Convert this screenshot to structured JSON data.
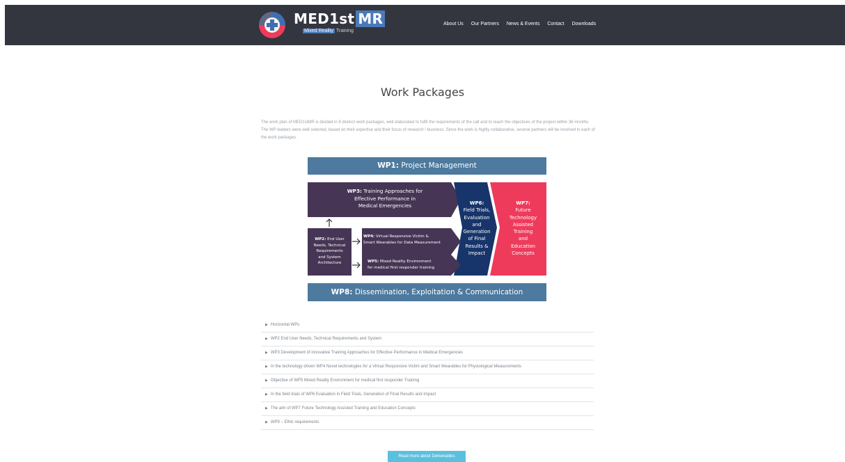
{
  "brand": {
    "name": "MED1st",
    "name_highlight": "MR",
    "subtitle_highlight": "Mixed Reality",
    "subtitle": "Training",
    "primary_color": "#33353f",
    "accent_color": "#4c7ab8"
  },
  "nav": {
    "items": [
      {
        "label": "About Us"
      },
      {
        "label": "Our Partners"
      },
      {
        "label": "News & Events"
      },
      {
        "label": "Contact"
      },
      {
        "label": "Downloads"
      }
    ]
  },
  "page": {
    "title": "Work Packages",
    "intro": "The work plan of MED1stMR is divided in 9 distinct work packages, well elaborated to fulfil the requirements of the call and to reach the objectives of the project within 36 months. The WP leaders were well selected, based on their expertise and their focus of research / business. Since the work is highly collaborative, several partners will be involved in each of the work packages."
  },
  "diagram": {
    "wp1": {
      "code": "WP1:",
      "text": "Project Management"
    },
    "wp3": {
      "code": "WP3:",
      "line1": "Training Approaches for",
      "line2": "Effective Performance in",
      "line3": "Medical Emergencies"
    },
    "wp2": {
      "code": "WP2:",
      "line1": "End User",
      "line2": "Needs, Technical",
      "line3": "Requirements",
      "line4": "and System",
      "line5": "Architecture"
    },
    "wp4": {
      "code": "WP4:",
      "line1": "Virtual Responsive Victim &",
      "line2": "Smart Wearables for Data Measurement"
    },
    "wp5": {
      "code": "WP5:",
      "line1": "Mixed Reality Environment",
      "line2": "for medical first responder training"
    },
    "wp6": {
      "code": "WP6:",
      "line1": "Field Trials,",
      "line2": "Evaluation",
      "line3": "and",
      "line4": "Generation",
      "line5": "of Final",
      "line6": "Results &",
      "line7": "Impact"
    },
    "wp7": {
      "code": "WP7:",
      "line1": "Future",
      "line2": "Technology",
      "line3": "Assisted",
      "line4": "Training",
      "line5": "and",
      "line6": "Education",
      "line7": "Concepts"
    },
    "wp8": {
      "code": "WP8:",
      "text": "Dissemination, Exploitation & Communication"
    },
    "colors": {
      "bar": "#4d7a9e",
      "purple": "#463554",
      "navy": "#17356b",
      "red": "#ee3b5c"
    }
  },
  "accordion": {
    "items": [
      {
        "label": "Horizontal WPs"
      },
      {
        "label": "WP2 End User Needs, Technical Requirements and System"
      },
      {
        "label": "WP3 Development of innovative Training Approaches for Effective Performance in Medical Emergencies"
      },
      {
        "label": "In the technology driven WP4 Novel technologies for a Virtual Responsive Victim and Smart Wearables for Physiological Measurements"
      },
      {
        "label": "Objective of WP5 Mixed Reality Environment for medical first responder Training"
      },
      {
        "label": "In the field trials of WP6 Evaluation in Field Trials, Generation of Final Results and Impact"
      },
      {
        "label": "The aim of WP7 Future Technology Assisted Training and Education Concepts"
      },
      {
        "label": "WP9 – Ethic requirements"
      }
    ]
  },
  "cta": {
    "label": "Read more about Deliverables",
    "color": "#5bc0de"
  }
}
